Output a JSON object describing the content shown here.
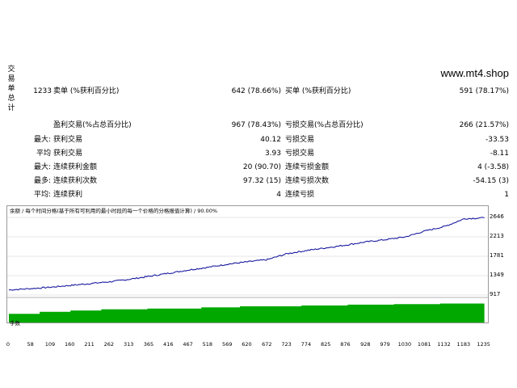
{
  "sidebar": {
    "label": [
      "交",
      "易",
      "单",
      "总",
      "计"
    ]
  },
  "watermark": "www.mt4.shop",
  "stats": {
    "r1": {
      "count": "1233",
      "l1": "卖单 (%获利百分比)",
      "v1": "642 (78.66%)",
      "l2": "买单 (%获利百分比)",
      "v2": "591 (78.17%)"
    },
    "r2": {
      "l1": "盈利交易(%占总百分比)",
      "v1": "967 (78.43%)",
      "l2": "亏损交易(%占总百分比)",
      "v2": "266 (21.57%)"
    },
    "r3": {
      "pre": "最大:",
      "l1": "获利交易",
      "v1": "40.12",
      "l2": "亏损交易",
      "v2": "-33.53"
    },
    "r4": {
      "pre": "平均",
      "l1": "获利交易",
      "v1": "3.93",
      "l2": "亏损交易",
      "v2": "-8.11"
    },
    "r5": {
      "pre": "最大:",
      "l1": "连续获利金额",
      "v1": "20 (90.70)",
      "l2": "连续亏损金额",
      "v2": "4 (-3.58)"
    },
    "r6": {
      "pre": "最多:",
      "l1": "连续获利次数",
      "v1": "97.32 (15)",
      "l2": "连续亏损次数",
      "v2": "-54.15 (3)"
    },
    "r7": {
      "pre": "平均:",
      "l1": "连续获利",
      "v1": "4",
      "l2": "连续亏损",
      "v2": "1"
    }
  },
  "chart": {
    "title": "余额 / 每个时间分格(基于所有可利用的最小时段的每一个价格的分格报值计算) / 90.00%",
    "volume_label": "手数",
    "colors": {
      "balance": "#1a1aa0",
      "volume": "#00a800",
      "grid": "#cfcfcf"
    }
  },
  "chart_data": {
    "type": "line",
    "title": "余额 / 每个时间分格(基于所有可利用的最小时段的每一个价格的分格报值计算) / 90.00%",
    "xlabel": "",
    "ylabel": "",
    "yticks": [
      "2646",
      "2213",
      "1781",
      "1349",
      "917"
    ],
    "xticks": [
      "0",
      "58",
      "109",
      "160",
      "211",
      "262",
      "313",
      "365",
      "416",
      "467",
      "518",
      "569",
      "620",
      "672",
      "723",
      "774",
      "825",
      "876",
      "928",
      "979",
      "1030",
      "1081",
      "1132",
      "1183",
      "1235"
    ],
    "xlim": [
      0,
      1240
    ],
    "ylim": [
      917,
      2700
    ],
    "series": [
      {
        "values": [
          [
            0,
            1030
          ],
          [
            58,
            1060
          ],
          [
            109,
            1090
          ],
          [
            160,
            1130
          ],
          [
            211,
            1170
          ],
          [
            262,
            1210
          ],
          [
            313,
            1265
          ],
          [
            365,
            1330
          ],
          [
            416,
            1400
          ],
          [
            467,
            1470
          ],
          [
            518,
            1530
          ],
          [
            569,
            1600
          ],
          [
            620,
            1650
          ],
          [
            672,
            1700
          ],
          [
            723,
            1830
          ],
          [
            774,
            1900
          ],
          [
            825,
            1960
          ],
          [
            876,
            2020
          ],
          [
            928,
            2090
          ],
          [
            979,
            2140
          ],
          [
            1030,
            2200
          ],
          [
            1081,
            2330
          ],
          [
            1132,
            2430
          ],
          [
            1183,
            2600
          ],
          [
            1235,
            2620
          ]
        ]
      }
    ],
    "volume": {
      "values": [
        [
          0,
          0.45
        ],
        [
          40,
          0.45
        ],
        [
          80,
          0.55
        ],
        [
          160,
          0.62
        ],
        [
          240,
          0.68
        ],
        [
          360,
          0.72
        ],
        [
          500,
          0.78
        ],
        [
          600,
          0.84
        ],
        [
          760,
          0.88
        ],
        [
          880,
          0.92
        ],
        [
          1000,
          0.95
        ],
        [
          1120,
          0.98
        ],
        [
          1235,
          1.0
        ]
      ]
    }
  }
}
